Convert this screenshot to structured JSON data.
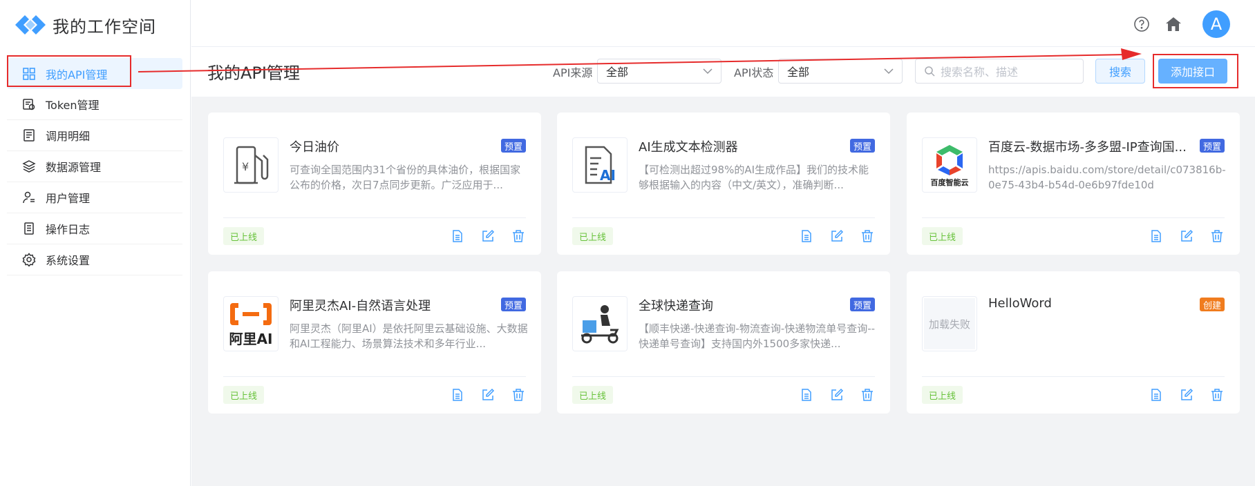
{
  "app": {
    "title": "我的工作空间",
    "brand_color": "#409eff"
  },
  "sidebar": {
    "items": [
      {
        "label": "我的API管理",
        "icon": "grid-icon",
        "active": true
      },
      {
        "label": "Token管理",
        "icon": "token-icon"
      },
      {
        "label": "调用明细",
        "icon": "receipt-icon"
      },
      {
        "label": "数据源管理",
        "icon": "layers-icon"
      },
      {
        "label": "用户管理",
        "icon": "user-list-icon"
      },
      {
        "label": "操作日志",
        "icon": "log-icon"
      },
      {
        "label": "系统设置",
        "icon": "gear-icon"
      }
    ]
  },
  "header": {
    "avatar_letter": "A"
  },
  "page": {
    "title": "我的API管理",
    "filters": {
      "source_label": "API来源",
      "source_value": "全部",
      "status_label": "API状态",
      "status_value": "全部"
    },
    "search_placeholder": "搜索名称、描述",
    "search_button": "搜索",
    "add_button": "添加接口"
  },
  "cards": [
    {
      "title": "今日油价",
      "badge": "预置",
      "badge_type": "preset",
      "desc": "可查询全国范围内31个省份的具体油价，根据国家公布的价格，次日7点同步更新。广泛应用于...",
      "status": "已上线",
      "thumb": "fuel-pump-icon"
    },
    {
      "title": "AI生成文本检测器",
      "badge": "预置",
      "badge_type": "preset",
      "desc": "【可检测出超过98%的AI生成作品】我们的技术能够根据输入的内容（中文/英文），准确判断...",
      "status": "已上线",
      "thumb": "ai-doc-icon"
    },
    {
      "title": "百度云-数据市场-多多盟-IP查询国...",
      "badge": "预置",
      "badge_type": "preset",
      "desc": "https://apis.baidu.com/store/detail/c073816b-0e75-43b4-b54d-0e6b97fde10d",
      "status": "已上线",
      "thumb": "baidu-cloud-logo",
      "thumb_caption": "百度智能云"
    },
    {
      "title": "阿里灵杰AI-自然语言处理",
      "badge": "预置",
      "badge_type": "preset",
      "desc": "阿里灵杰（阿里AI）是依托阿里云基础设施、大数据和AI工程能力、场景算法技术和多年行业...",
      "status": "已上线",
      "thumb": "aliyun-ai-logo",
      "thumb_caption": "阿里AI"
    },
    {
      "title": "全球快递查询",
      "badge": "预置",
      "badge_type": "preset",
      "desc": "【顺丰快递-快递查询-物流查询-快递物流单号查询--快递单号查询】支持国内外1500多家快递...",
      "status": "已上线",
      "thumb": "courier-scooter-icon"
    },
    {
      "title": "HelloWord",
      "badge": "创建",
      "badge_type": "created",
      "desc": "",
      "status": "已上线",
      "thumb": "load-failed",
      "thumb_caption": "加载失败"
    }
  ]
}
